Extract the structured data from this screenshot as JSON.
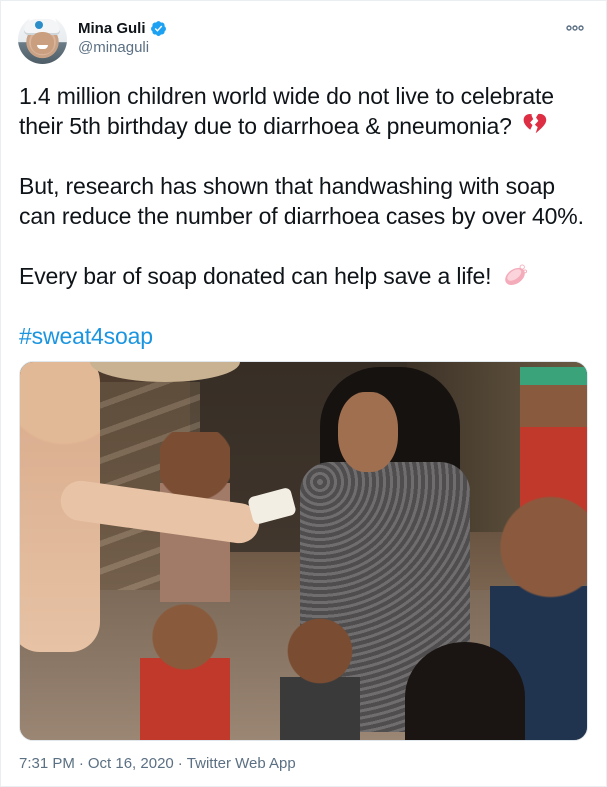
{
  "author": {
    "display_name": "Mina Guli",
    "handle": "@minaguli",
    "verified": true,
    "avatar_icon": "profile-photo"
  },
  "tweet": {
    "paragraphs": [
      {
        "text": "1.4 million children world wide do not live to celebrate their 5th birthday due to diarrhoea & pneumonia?",
        "emoji": "broken-heart-icon"
      },
      {
        "text": "But, research has shown that handwashing with soap can reduce the number of diarrhoea cases by over 40%.",
        "emoji": null
      },
      {
        "text": "Every bar of soap donated can help save a life!",
        "emoji": "soap-icon"
      }
    ],
    "hashtag": "#sweat4soap",
    "media_icon": "photo-woman-giving-soap-to-children"
  },
  "meta": {
    "time": "7:31 PM",
    "separator": "·",
    "date": "Oct 16, 2020",
    "source": "Twitter Web App"
  },
  "colors": {
    "accent": "#1b95e0",
    "verified": "#1da1f2",
    "secondary_text": "#5b7083",
    "emoji_heart": "#dd2e44",
    "emoji_soap": "#f4abba"
  }
}
